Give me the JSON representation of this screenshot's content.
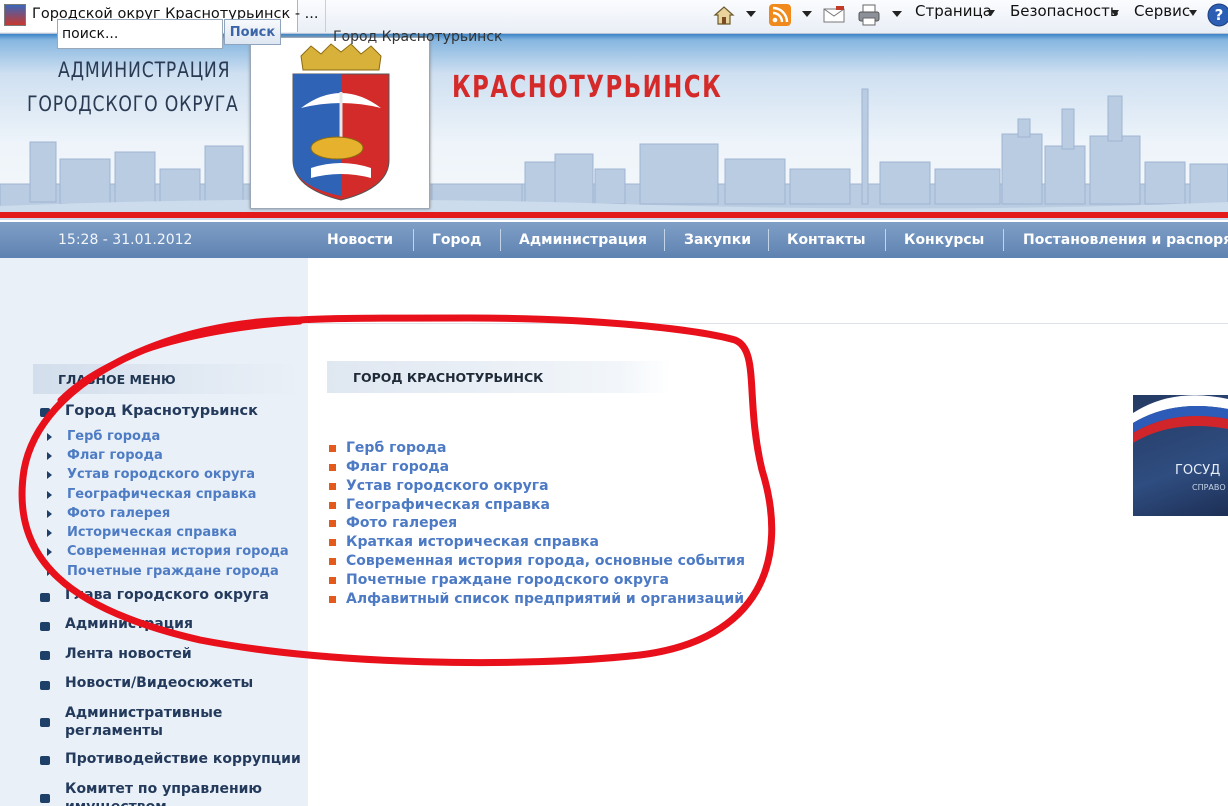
{
  "browser": {
    "tab_title": "Городской округ Краснотурьинск - ...",
    "menus": [
      "Страница",
      "Безопасность",
      "Сервис"
    ],
    "icons": [
      "home-icon",
      "rss-feed-icon",
      "read-mail-icon",
      "print-icon",
      "help-icon"
    ]
  },
  "header": {
    "admin_line1": "АДМИНИСТРАЦИЯ",
    "admin_line2": "ГОРОДСКОГО ОКРУГА",
    "city_title": "КРАСНОТУРЬИНСК",
    "accent_red": "#e41b1b",
    "nav_color": "#6f92be"
  },
  "nav": {
    "datetime": "15:28 - 31.01.2012",
    "items": [
      "Новости",
      "Город",
      "Администрация",
      "Закупки",
      "Контакты",
      "Конкурсы",
      "Постановления и распоря"
    ]
  },
  "search": {
    "value": "поиск...",
    "button": "Поиск"
  },
  "breadcrumb": "Город Краснотурьинск",
  "sidebar": {
    "title": "ГЛАВНОЕ МЕНЮ",
    "items": [
      {
        "label": "Город Краснотурьинск"
      },
      {
        "label": "Глава городского округа"
      },
      {
        "label": "Администрация"
      },
      {
        "label": "Лента новостей"
      },
      {
        "label": "Новости/Видеосюжеты"
      },
      {
        "label": "Административные регламенты"
      },
      {
        "label": "Противодействие коррупции"
      },
      {
        "label": "Комитет по управлению имуществом"
      }
    ],
    "subitems": [
      "Герб города",
      "Флаг города",
      "Устав городского округа",
      "Географическая справка",
      "Фото галерея",
      "Историческая справка",
      "Современная история города",
      "Почетные граждане города"
    ]
  },
  "content": {
    "section_title": "ГОРОД КРАСНОТУРЬИНСК",
    "links": [
      "Герб города",
      "Флаг города",
      "Устав городского округа",
      "Географическая справка",
      "Фото галерея",
      "Краткая историческая справка",
      "Современная история города, основные события",
      "Почетные граждане городского округа",
      "Алфавитный список предприятий и организаций"
    ],
    "bullet_color": "#e25a1c",
    "link_color": "#4d7ac4"
  },
  "banner": {
    "text1": "ГОСУД",
    "text2": "СПРАВО"
  }
}
